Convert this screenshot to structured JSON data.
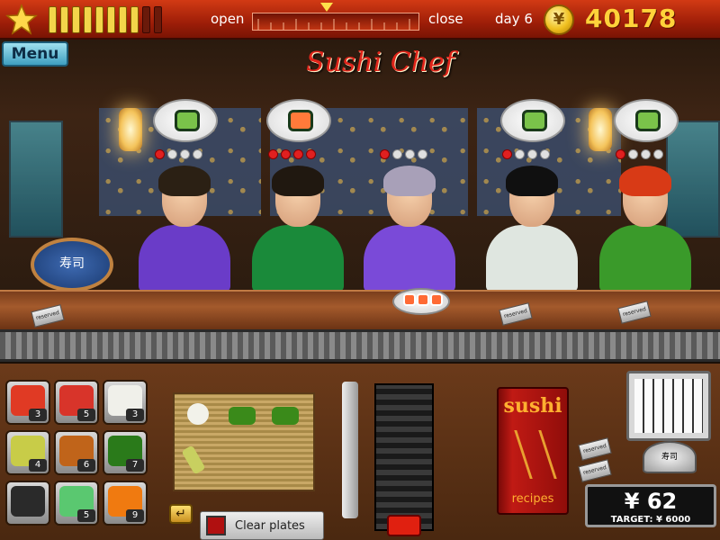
{
  "hud": {
    "open_label": "open",
    "close_label": "close",
    "day_label": "day 6",
    "coin_symbol": "¥",
    "money": "40178",
    "mood_level": 0.8
  },
  "menu": {
    "label": "Menu"
  },
  "scene": {
    "title": "Sushi Chef",
    "sign_text": "寿司",
    "customers": [
      {
        "order_icon": "maki-roll-icon",
        "patience_dots": [
          "red",
          "white",
          "white",
          "white"
        ],
        "hair_color": "#2b2014",
        "shirt_color": "#6a3cc8"
      },
      {
        "order_icon": "salmon-roe-icon",
        "patience_dots": [
          "red",
          "red",
          "red",
          "red"
        ],
        "hair_color": "#201810",
        "shirt_color": "#1a8a3a"
      },
      {
        "order_icon": "",
        "patience_dots": [
          "red",
          "white",
          "white",
          "white"
        ],
        "hair_color": "#a8a0b8",
        "shirt_color": "#7a4ad8"
      },
      {
        "order_icon": "maki-roll-icon",
        "patience_dots": [
          "red",
          "white",
          "white",
          "white"
        ],
        "hair_color": "#101010",
        "shirt_color": "#dfe6e0"
      },
      {
        "order_icon": "maki-roll-icon",
        "patience_dots": [
          "red",
          "white",
          "white",
          "white"
        ],
        "hair_color": "#d83a16",
        "shirt_color": "#3a9a2a"
      }
    ],
    "reserved_label": "reserved"
  },
  "ingredients": [
    {
      "name": "tuna",
      "count": "3",
      "color": "#e03a24"
    },
    {
      "name": "salmon",
      "count": "5",
      "color": "#d8342a"
    },
    {
      "name": "rice",
      "count": "3",
      "color": "#f0f0ea"
    },
    {
      "name": "cucumber",
      "count": "4",
      "color": "#c8cc48"
    },
    {
      "name": "shrimp",
      "count": "6",
      "color": "#c0641a"
    },
    {
      "name": "seaweed",
      "count": "7",
      "color": "#2a7a1a"
    },
    {
      "name": "empty",
      "count": "",
      "color": "#2a2a2a"
    },
    {
      "name": "avocado",
      "count": "5",
      "color": "#5ac870"
    },
    {
      "name": "roe",
      "count": "9",
      "color": "#f07a10"
    }
  ],
  "recipes": {
    "title": "sushi",
    "label": "recipes"
  },
  "register": {
    "amount": "¥ 62",
    "target": "TARGET: ¥ 6000",
    "bell_text": "寿司"
  },
  "controls": {
    "clear_plates": "Clear plates",
    "return_symbol": "↵"
  }
}
